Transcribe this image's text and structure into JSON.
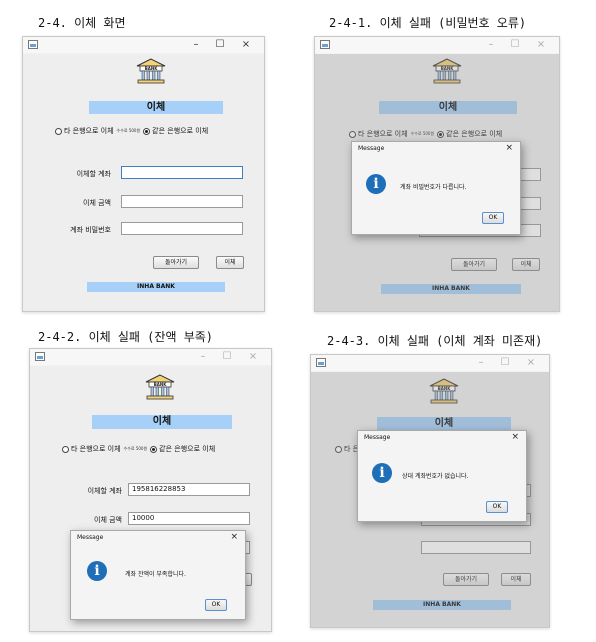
{
  "captions": {
    "p1": "2-4. 이체 화면",
    "p2": "2-4-1. 이체 실패 (비밀번호 오류)",
    "p3": "2-4-2. 이체 실패 (잔액 부족)",
    "p4": "2-4-3. 이체 실패 (이체 계좌 미존재)"
  },
  "window": {
    "minimize": "–",
    "maximize": "☐",
    "close": "×",
    "logo_text": "BANK",
    "title": "이체",
    "radio_other": "타 은행으로 이체",
    "fee_note": "수수료 500원",
    "radio_same": "같은 은행으로 이체",
    "label_account": "이체할 계좌",
    "label_amount": "이체 금액",
    "label_password": "계좌 비밀번호",
    "back_button": "돌아가기",
    "transfer_button": "이체",
    "footer": "INHA BANK"
  },
  "panel3_values": {
    "account": "195816228853",
    "amount": "10000"
  },
  "dialog": {
    "title": "Message",
    "close": "×",
    "icon_letter": "i",
    "ok": "OK"
  },
  "messages": {
    "password_error": "계좌 비밀번호가 다릅니다.",
    "insufficient": "계좌 잔액이 부족합니다.",
    "no_account": "상대 계좌번호가 없습니다."
  },
  "colors": {
    "accent": "#a6d0f7",
    "info_icon": "#1f6fb8"
  }
}
